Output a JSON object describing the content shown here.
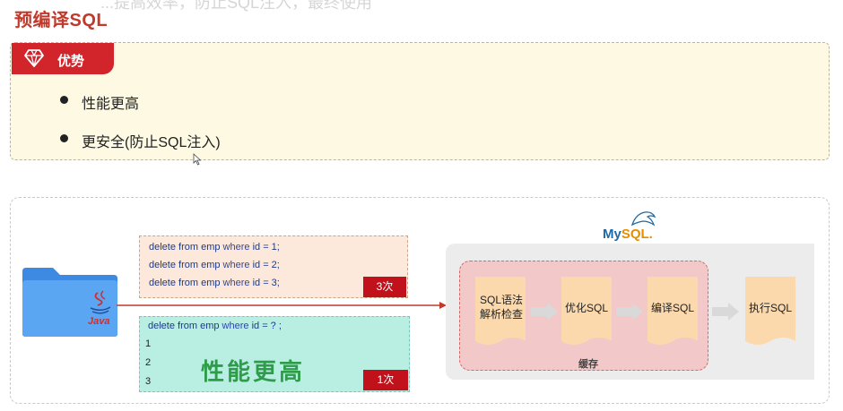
{
  "header": {
    "title": "预编译SQL",
    "cut_off_text": "...提高效率，防止SQL注入，最终使用"
  },
  "advantages": {
    "label": "优势",
    "items": [
      "性能更高",
      "更安全(防止SQL注入)"
    ]
  },
  "diagram": {
    "java_label": "Java",
    "queries_plain": [
      {
        "prefix": "delete from emp ",
        "kw": "where",
        "suffix": " id = 1;"
      },
      {
        "prefix": "delete from emp ",
        "kw": "where",
        "suffix": " id = 2;"
      },
      {
        "prefix": "delete from emp ",
        "kw": "where",
        "suffix": " id = 3;"
      }
    ],
    "plain_count": "3次",
    "query_prepared": {
      "prefix": "delete from emp ",
      "kw": "where",
      "suffix": " id = ? ;"
    },
    "param_rows": [
      "1",
      "2",
      "3"
    ],
    "prepared_count": "1次",
    "performance_text": "性能更高",
    "mysql_logo": {
      "my": "My",
      "sql": "SQL."
    },
    "steps": [
      "SQL语法\n解析检查",
      "优化SQL",
      "编译SQL",
      "执行SQL"
    ],
    "cache_label": "缓存",
    "colors": {
      "accent_red": "#d1242b",
      "cache_fill": "#f3c8c8",
      "step_fill": "#fbd9ad",
      "plain_box": "#fde9dc",
      "prepared_box": "#b8efe2",
      "perf_text": "#2e9c48"
    }
  }
}
